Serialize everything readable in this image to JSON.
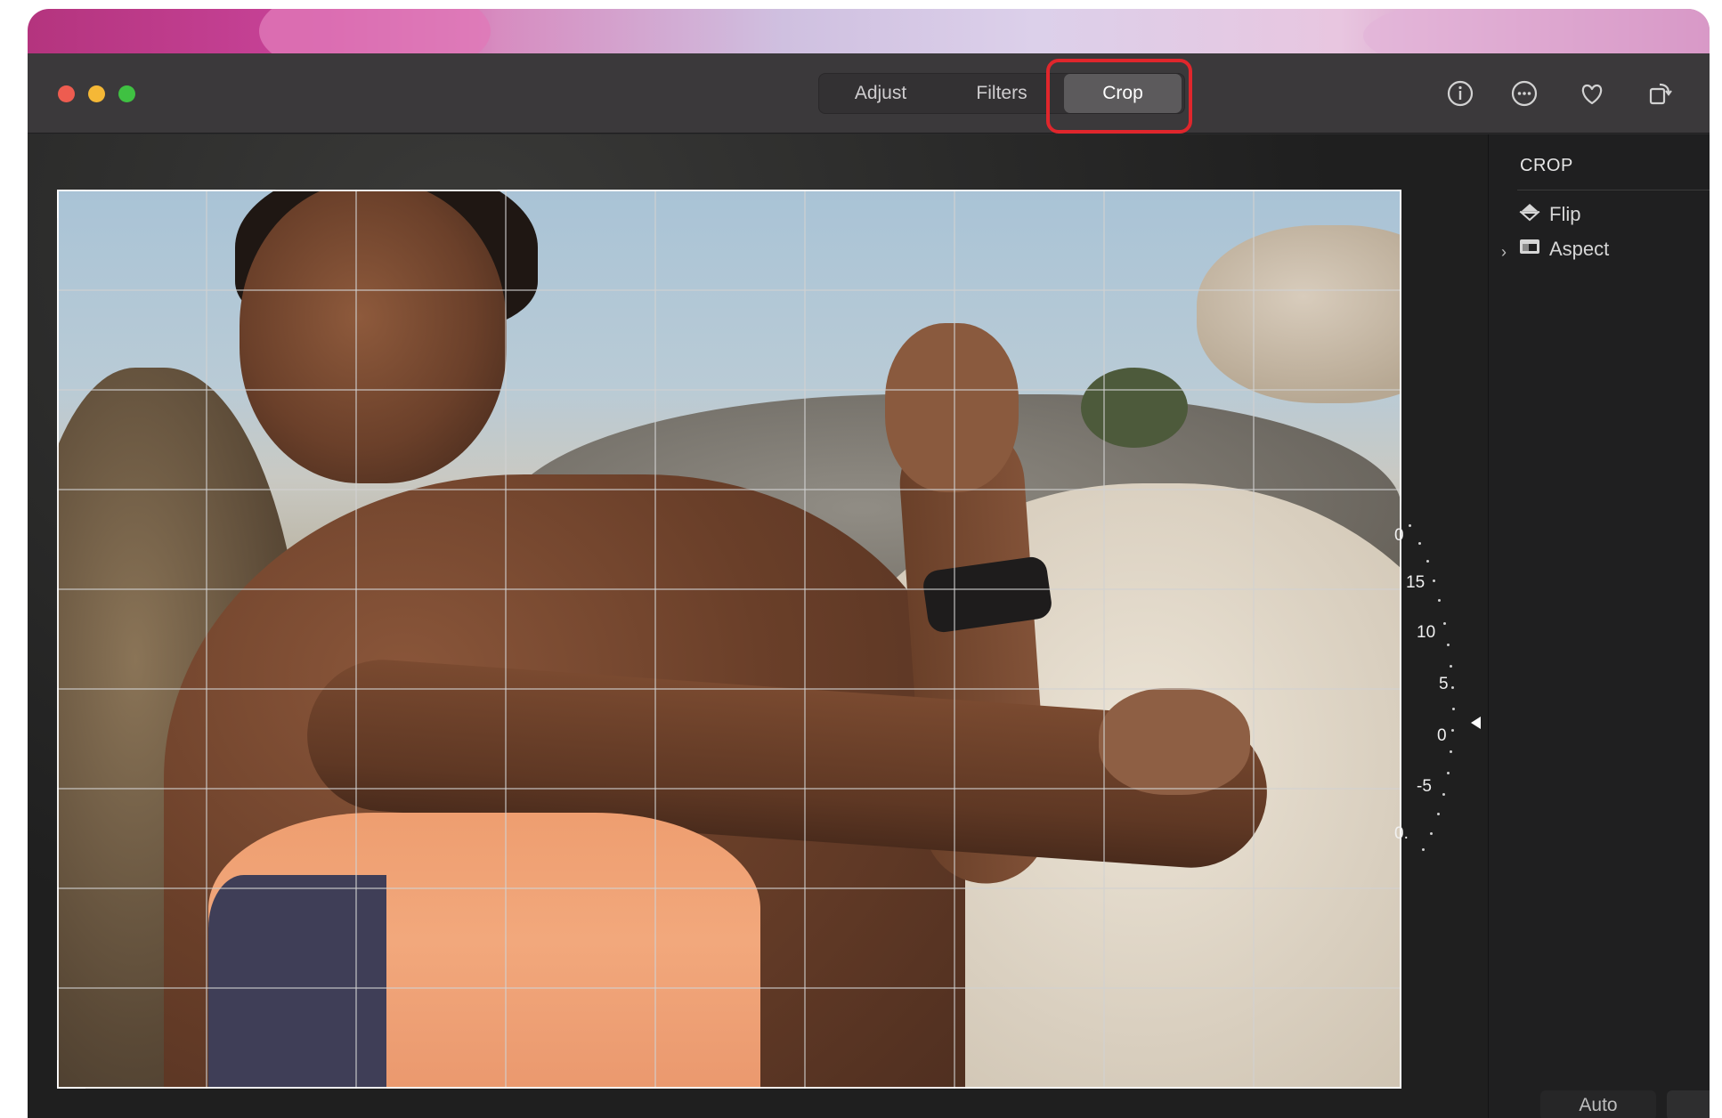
{
  "window": {
    "controls": [
      "close",
      "minimize",
      "zoom"
    ],
    "colors": {
      "close": "#ee5c50",
      "minimize": "#f5b836",
      "zoom": "#3fc142"
    }
  },
  "toolbar": {
    "tabs": [
      {
        "label": "Adjust",
        "selected": false
      },
      {
        "label": "Filters",
        "selected": false
      },
      {
        "label": "Crop",
        "selected": true
      }
    ],
    "highlight_color": "#e0262c",
    "icons": [
      "info-icon",
      "more-options-icon",
      "favorite-heart-icon",
      "rotate-icon"
    ]
  },
  "sidebar": {
    "title": "CROP",
    "items": [
      {
        "label": "Flip",
        "icon": "flip-icon"
      },
      {
        "label": "Aspect",
        "icon": "aspect-icon",
        "expandable": true
      }
    ],
    "auto_label": "Auto"
  },
  "dial": {
    "labels": [
      "0",
      "15",
      "10",
      "5",
      "0",
      "-5",
      "0."
    ]
  }
}
